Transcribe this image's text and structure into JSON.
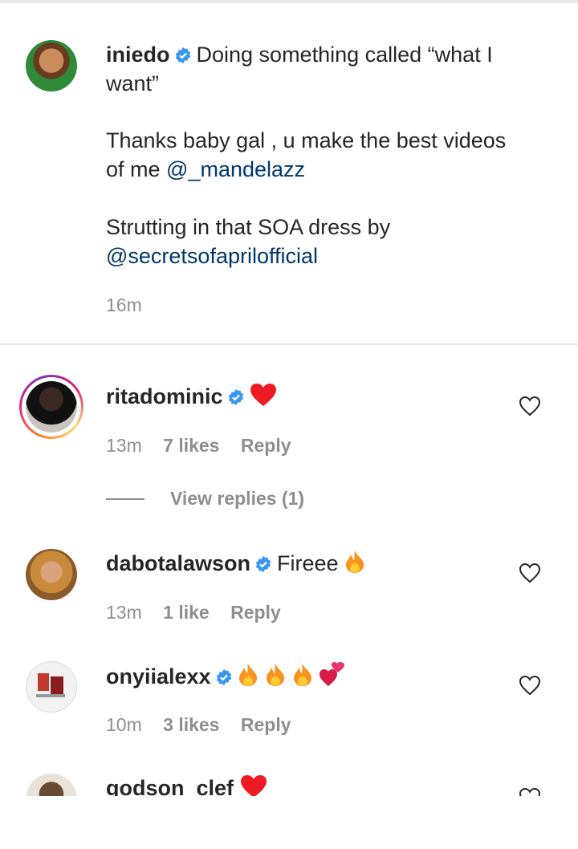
{
  "caption": {
    "username": "iniedo",
    "line1": "Doing something called “what I",
    "line2": "want”",
    "line3": "Thanks baby gal , u make the best videos",
    "line4_prefix": "of me ",
    "mention1": "@_mandelazz",
    "line5": "Strutting in that SOA dress by",
    "mention2": "@secretsofaprilofficial",
    "time": "16m"
  },
  "comments": [
    {
      "username": "ritadominic",
      "text": "",
      "time": "13m",
      "likes": "7 likes",
      "reply": "Reply",
      "view_replies": "View replies (1)"
    },
    {
      "username": "dabotalawson",
      "text": "Fireee",
      "time": "13m",
      "likes": "1 like",
      "reply": "Reply"
    },
    {
      "username": "onyiialexx",
      "text": "",
      "time": "10m",
      "likes": "3 likes",
      "reply": "Reply"
    },
    {
      "username": "godson_clef",
      "text": ""
    }
  ],
  "colors": {
    "link": "#00376b",
    "verified": "#3897f0",
    "meta": "#8e8e8e",
    "heart_red": "#ed1c24"
  }
}
